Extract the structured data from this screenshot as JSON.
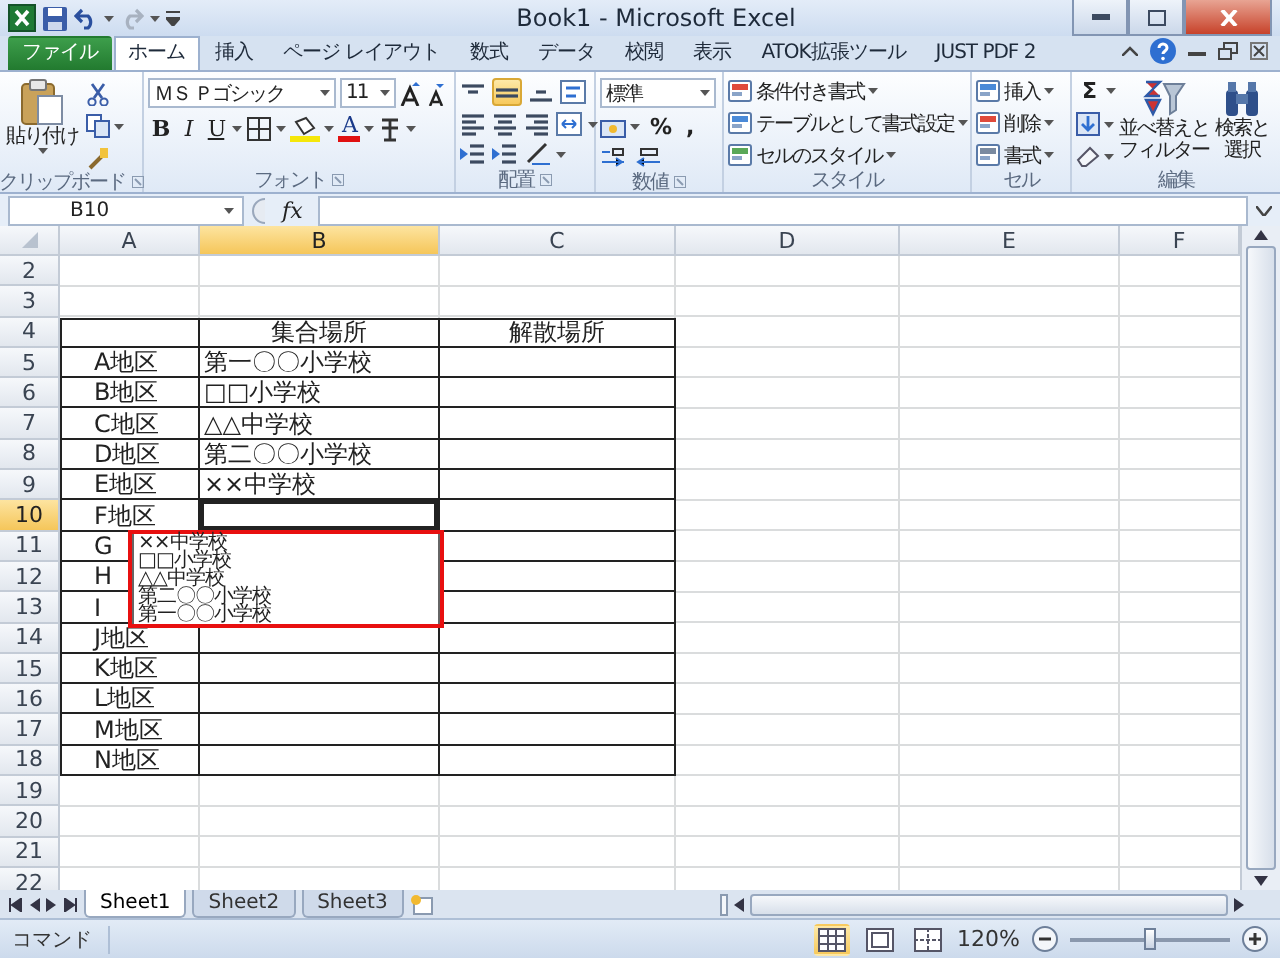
{
  "window": {
    "title": "Book1 - Microsoft Excel"
  },
  "ribbon_tabs": [
    {
      "label": "ファイル",
      "kind": "file",
      "selected": false
    },
    {
      "label": "ホーム",
      "kind": "tab",
      "selected": true
    },
    {
      "label": "挿入",
      "kind": "tab",
      "selected": false
    },
    {
      "label": "ページ レイアウト",
      "kind": "tab",
      "selected": false
    },
    {
      "label": "数式",
      "kind": "tab",
      "selected": false
    },
    {
      "label": "データ",
      "kind": "tab",
      "selected": false
    },
    {
      "label": "校閲",
      "kind": "tab",
      "selected": false
    },
    {
      "label": "表示",
      "kind": "tab",
      "selected": false
    },
    {
      "label": "ATOK拡張ツール",
      "kind": "tab",
      "selected": false
    },
    {
      "label": "JUST PDF 2",
      "kind": "tab",
      "selected": false
    }
  ],
  "clipboard": {
    "paste": "貼り付け",
    "label": "クリップボード"
  },
  "font": {
    "name": "ＭＳ Ｐゴシック",
    "size": "11",
    "style_buttons": [
      {
        "label": "B",
        "kind": "bold"
      },
      {
        "label": "I",
        "kind": "italic"
      },
      {
        "label": "U",
        "kind": "underline"
      }
    ],
    "color_button": "A",
    "label": "フォント"
  },
  "alignment": {
    "label": "配置"
  },
  "number": {
    "format": "標準",
    "symbols": [
      "%",
      ","
    ],
    "label": "数値"
  },
  "styles": {
    "items": [
      "条件付き書式",
      "テーブルとして書式設定",
      "セルのスタイル"
    ],
    "label": "スタイル"
  },
  "cells": {
    "items": [
      "挿入",
      "削除",
      "書式"
    ],
    "label": "セル"
  },
  "editing": {
    "sum": "Σ",
    "sort": [
      "並べ替えと",
      "フィルター"
    ],
    "find": [
      "検索と",
      "選択"
    ],
    "label": "編集"
  },
  "name_box": "B10",
  "formula_label": "fx",
  "columns": [
    {
      "label": "A",
      "selected": false
    },
    {
      "label": "B",
      "selected": true
    },
    {
      "label": "C",
      "selected": false
    },
    {
      "label": "D",
      "selected": false
    },
    {
      "label": "E",
      "selected": false
    },
    {
      "label": "F",
      "selected": false
    }
  ],
  "rows": [
    {
      "number": "2",
      "bordered": false,
      "selected": false
    },
    {
      "number": "3",
      "bordered": false,
      "selected": false
    },
    {
      "number": "4",
      "bordered": true,
      "selected": false,
      "b": "集合場所",
      "c": "解散場所"
    },
    {
      "number": "5",
      "bordered": true,
      "selected": false,
      "a": "A地区",
      "b": "第一〇〇小学校"
    },
    {
      "number": "6",
      "bordered": true,
      "selected": false,
      "a": "B地区",
      "b": "□□小学校"
    },
    {
      "number": "7",
      "bordered": true,
      "selected": false,
      "a": "C地区",
      "b": "△△中学校"
    },
    {
      "number": "8",
      "bordered": true,
      "selected": false,
      "a": "D地区",
      "b": "第二〇〇小学校"
    },
    {
      "number": "9",
      "bordered": true,
      "selected": false,
      "a": "E地区",
      "b": "××中学校"
    },
    {
      "number": "10",
      "bordered": true,
      "selected": true,
      "a": "F地区"
    },
    {
      "number": "11",
      "bordered": true,
      "selected": false,
      "a": "G"
    },
    {
      "number": "12",
      "bordered": true,
      "selected": false,
      "a": "H"
    },
    {
      "number": "13",
      "bordered": true,
      "selected": false,
      "a": "I"
    },
    {
      "number": "14",
      "bordered": true,
      "selected": false,
      "a": "J地区"
    },
    {
      "number": "15",
      "bordered": true,
      "selected": false,
      "a": "K地区"
    },
    {
      "number": "16",
      "bordered": true,
      "selected": false,
      "a": "L地区"
    },
    {
      "number": "17",
      "bordered": true,
      "selected": false,
      "a": "M地区"
    },
    {
      "number": "18",
      "bordered": true,
      "selected": false,
      "a": "N地区"
    },
    {
      "number": "19",
      "bordered": false,
      "selected": false
    },
    {
      "number": "20",
      "bordered": false,
      "selected": false
    },
    {
      "number": "21",
      "bordered": false,
      "selected": false
    },
    {
      "number": "22",
      "bordered": false,
      "selected": false
    }
  ],
  "dropdown": {
    "highlighted": true,
    "items": [
      "××中学校",
      "□□小学校",
      "△△中学校",
      "第二〇〇小学校",
      "第一〇〇小学校"
    ]
  },
  "sheet_tabs": [
    {
      "label": "Sheet1",
      "selected": true
    },
    {
      "label": "Sheet2",
      "selected": false
    },
    {
      "label": "Sheet3",
      "selected": false
    }
  ],
  "status_bar": {
    "mode": "コマンド",
    "views": [
      {
        "kind": "normal",
        "selected": true
      },
      {
        "kind": "layout",
        "selected": false
      },
      {
        "kind": "break",
        "selected": false
      }
    ],
    "zoom": "120%",
    "zoom_slider": {
      "level": 0.5
    }
  }
}
